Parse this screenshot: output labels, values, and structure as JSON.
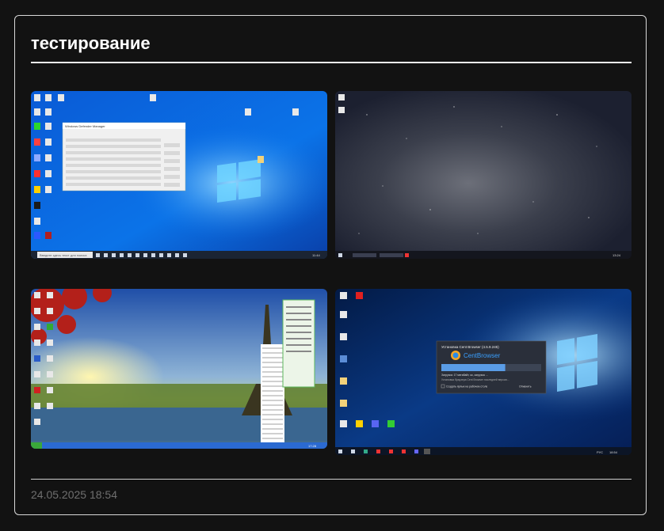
{
  "post": {
    "title": "тестирование",
    "date": "24.05.2025 18:54"
  },
  "screenshots": [
    {
      "theme": "windows-10-blue",
      "window_title": "Windows Defender Manager",
      "taskbar_search": "Введите здесь текст для поиска",
      "taskbar_time": "11:44"
    },
    {
      "theme": "night-sky",
      "taskbar_time": "13:24"
    },
    {
      "theme": "paris-eiffel",
      "taskbar_time": "17:28"
    },
    {
      "theme": "windows-10-dark-blue",
      "dialog_title": "Установка Cent Browser (4.5.9.245)",
      "dialog_brand": "CentBrowser",
      "dialog_status": "Загрузка: 17 мегабайт, ок, загрузка …",
      "dialog_status2": "Установка браузера Cent Browser последней версии...",
      "dialog_checkbox": "Создать ярлык на рабочем столе",
      "dialog_cancel": "Отменить",
      "progress": 0.64,
      "taskbar_time": "18:54",
      "taskbar_lang": "РУС"
    }
  ],
  "colors": {
    "background": "#121212",
    "border": "#d9d9d9",
    "title": "#ffffff",
    "date": "#6f6f6f"
  }
}
